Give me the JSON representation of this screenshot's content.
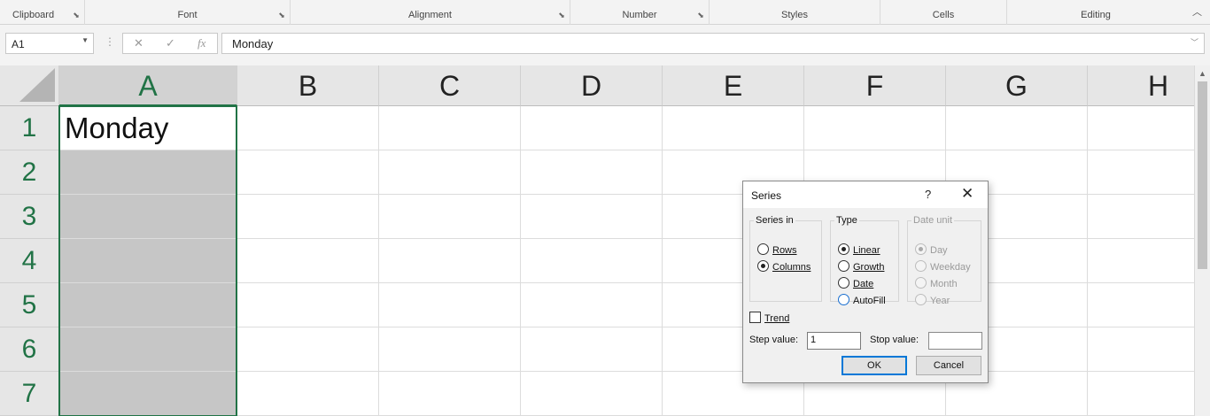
{
  "ribbon": {
    "groups": [
      {
        "label": "Clipboard"
      },
      {
        "label": "Font"
      },
      {
        "label": "Alignment"
      },
      {
        "label": "Number"
      },
      {
        "label": "Styles"
      },
      {
        "label": "Cells"
      },
      {
        "label": "Editing"
      }
    ]
  },
  "formula_bar": {
    "name_box": "A1",
    "cancel_glyph": "✕",
    "enter_glyph": "✓",
    "fx_label": "fx",
    "content": "Monday"
  },
  "sheet": {
    "columns": [
      "A",
      "B",
      "C",
      "D",
      "E",
      "F",
      "G",
      "H"
    ],
    "rows": [
      "1",
      "2",
      "3",
      "4",
      "5",
      "6",
      "7"
    ],
    "cells": {
      "A1": "Monday"
    },
    "selected_column": "A",
    "selection": "A1:A7",
    "accent_color": "#217346"
  },
  "dialog": {
    "title": "Series",
    "help": "?",
    "close": "✕",
    "series_in": {
      "legend": "Series in",
      "options": [
        {
          "label": "Rows",
          "checked": false
        },
        {
          "label": "Columns",
          "checked": true
        }
      ]
    },
    "type": {
      "legend": "Type",
      "options": [
        {
          "label": "Linear",
          "checked": true
        },
        {
          "label": "Growth",
          "checked": false
        },
        {
          "label": "Date",
          "checked": false
        },
        {
          "label": "AutoFill",
          "checked": false
        }
      ]
    },
    "date_unit": {
      "legend": "Date unit",
      "disabled": true,
      "options": [
        {
          "label": "Day",
          "checked": true
        },
        {
          "label": "Weekday",
          "checked": false
        },
        {
          "label": "Month",
          "checked": false
        },
        {
          "label": "Year",
          "checked": false
        }
      ]
    },
    "trend_label": "Trend",
    "trend_checked": false,
    "step_value_label": "Step value:",
    "step_value": "1",
    "stop_value_label": "Stop value:",
    "stop_value": "",
    "ok_label": "OK",
    "cancel_label": "Cancel"
  }
}
